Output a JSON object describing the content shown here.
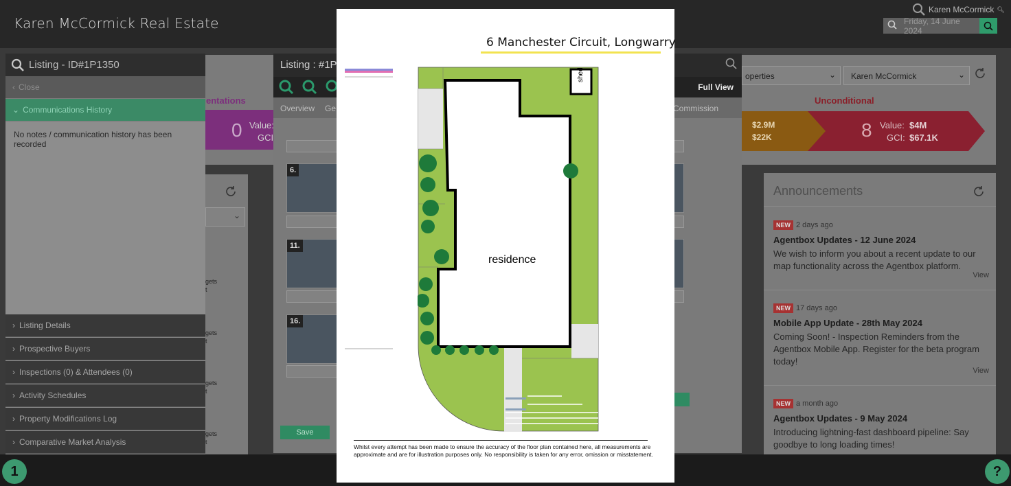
{
  "app": {
    "title": "Karen McCormick Real Estate"
  },
  "header": {
    "user_name": "Karen McCormick",
    "date_placeholder": "Friday, 14 June 2024"
  },
  "left_panel": {
    "title": "Listing - ID#1P1350",
    "close_label": "Close",
    "comm_history_label": "Communications History",
    "empty_note": "No notes / communication history has been recorded",
    "menu": [
      "Listing Details",
      "Prospective Buyers",
      "Inspections (0) & Attendees (0)",
      "Activity Schedules",
      "Property Modifications Log",
      "Comparative Market Analysis"
    ]
  },
  "middle_panel": {
    "title": "Listing : #1P1",
    "full_view": "Full View",
    "tabs": [
      "Overview",
      "Ge",
      "Commission"
    ],
    "thumbs": [
      "6.",
      "11.",
      "16."
    ],
    "save_label": "Save"
  },
  "dashboard": {
    "presentations_label": "entations",
    "presentations_count": "0",
    "value_label": "Value:",
    "gci_label": "GCI:",
    "tile2_value": "$2.9M",
    "tile2_gci": "$22K",
    "unconditional_label": "Unconditional",
    "unconditional_count": "8",
    "unconditional_value": "$4M",
    "unconditional_gci": "$67.1K",
    "filter1": "operties",
    "filter2": "Karen McCormick",
    "budgets": [
      "gets",
      "t",
      "gets",
      "t",
      "gets",
      "t",
      "gets",
      "t"
    ]
  },
  "announcements": {
    "title": "Announcements",
    "items": [
      {
        "badge": "NEW",
        "ago": "2 days ago",
        "title": "Agentbox Updates - 12 June 2024",
        "body": "We wish to inform you about a recent update to our map functionality across the Agentbox platform.",
        "view": "View"
      },
      {
        "badge": "NEW",
        "ago": "17 days ago",
        "title": "Mobile App Update - 28th May 2024",
        "body": "Coming Soon! - Inspection Reminders from the Agentbox Mobile App. Register for the beta program today!",
        "view": "View"
      },
      {
        "badge": "NEW",
        "ago": "a month ago",
        "title": "Agentbox Updates - 9 May 2024",
        "body": "Introducing lightning-fast dashboard pipeline: Say goodbye to long loading times!",
        "view": ""
      }
    ]
  },
  "floorplan": {
    "address": "6 Manchester Circuit, Longwarry",
    "shed_label": "shed",
    "residence_label": "residence",
    "disclaimer": "Whilst every attempt has been made to ensure the accuracy of the floor plan contained here, all measurements are approximate and are for illustration purposes only. No responsibility is taken for any error, omission or misstatement.",
    "colors": {
      "lawn": "#9bc34f",
      "paving": "#e6e6e6",
      "trees": "#1e7a3a",
      "underline": "#f2e350"
    }
  },
  "footer": {
    "left_circle": "1",
    "right_circle": "?"
  }
}
